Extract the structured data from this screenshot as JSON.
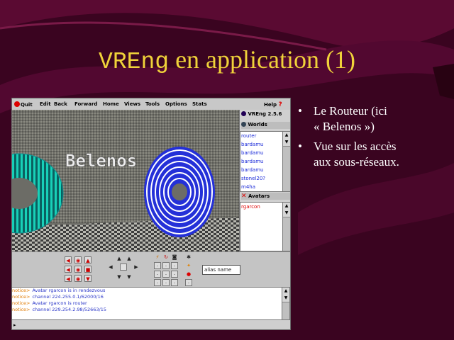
{
  "slide": {
    "title_mono": "VREng",
    "title_rest": " en application (1)",
    "bullets": [
      {
        "line1": "Le Routeur (ici",
        "line2": "« Belenos »)"
      },
      {
        "line1": "Vue sur les accès",
        "line2": "aux sous-réseaux."
      }
    ],
    "bullet_glyph": "•"
  },
  "colors": {
    "title": "#f0d23a",
    "background": "#3a0420",
    "chat_tag": "#e07a00",
    "chat_msg": "#2a36c8",
    "list_text": "#1a2ad8",
    "ring_blue": "#2430d8",
    "ring_teal": "#10c8b0"
  },
  "app": {
    "menu": [
      "Quit",
      "Edit",
      "Back",
      "Forward",
      "Home",
      "Views",
      "Tools",
      "Options",
      "Stats"
    ],
    "help": "Help",
    "help_icon": "?",
    "version": "VREng 2.5.6",
    "worlds_header": "Worlds",
    "worlds": [
      "router",
      "bardamu",
      "bardamu",
      "bardamu",
      "bardamu",
      "stonel20?",
      "m4ha"
    ],
    "avatars_header": "Avatars",
    "avatars": [
      "rgarcon"
    ],
    "scene_sign": "Belenos",
    "alias_label": "alias name",
    "chat": [
      {
        "tag": "notice>",
        "msg": "Avatar rgarcon is in rendezvous"
      },
      {
        "tag": "notice>",
        "msg": "channel 224.255.0.1/62000/16"
      },
      {
        "tag": "notice>",
        "msg": "Avatar rgarcon is router"
      },
      {
        "tag": "notice>",
        "msg": "channel 229.254.2.98/52663/15"
      }
    ],
    "chat_prompt": "▸"
  }
}
